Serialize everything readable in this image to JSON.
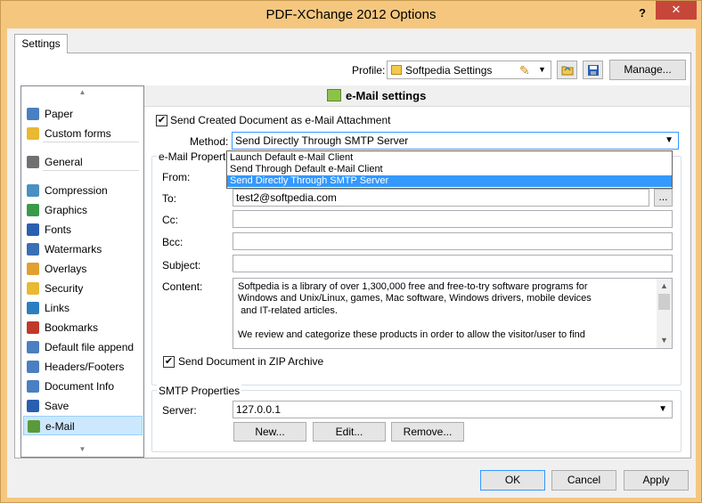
{
  "window": {
    "title": "PDF-XChange 2012 Options",
    "help_label": "?",
    "close_label": "✕"
  },
  "tabs": [
    {
      "label": "Settings"
    }
  ],
  "profile": {
    "label": "Profile:",
    "value": "Softpedia Settings",
    "manage_label": "Manage..."
  },
  "sidebar": {
    "items": [
      {
        "label": "Paper",
        "icon": "paper-icon",
        "color": "#4a7fc1"
      },
      {
        "label": "Custom forms",
        "icon": "custom-forms-icon",
        "color": "#e8b931"
      },
      {
        "label": "General",
        "icon": "gear-icon",
        "color": "#707070"
      },
      {
        "label": "Compression",
        "icon": "compression-icon",
        "color": "#4a90c2"
      },
      {
        "label": "Graphics",
        "icon": "graphics-icon",
        "color": "#3a9a4a"
      },
      {
        "label": "Fonts",
        "icon": "fonts-icon",
        "color": "#2a5fb0"
      },
      {
        "label": "Watermarks",
        "icon": "watermarks-icon",
        "color": "#3a6fb5"
      },
      {
        "label": "Overlays",
        "icon": "overlays-icon",
        "color": "#e0a030"
      },
      {
        "label": "Security",
        "icon": "shield-icon",
        "color": "#e8b931"
      },
      {
        "label": "Links",
        "icon": "links-icon",
        "color": "#2a7fc0"
      },
      {
        "label": "Bookmarks",
        "icon": "bookmarks-icon",
        "color": "#c0392b"
      },
      {
        "label": "Default file append",
        "icon": "file-append-icon",
        "color": "#4a7fc1"
      },
      {
        "label": "Headers/Footers",
        "icon": "headers-footers-icon",
        "color": "#4a7fc1"
      },
      {
        "label": "Document Info",
        "icon": "document-info-icon",
        "color": "#4a7fc1"
      },
      {
        "label": "Save",
        "icon": "save-icon",
        "color": "#2a5fb0"
      },
      {
        "label": "e-Mail",
        "icon": "email-icon",
        "color": "#5a9a3a"
      }
    ],
    "selected": "e-Mail"
  },
  "email": {
    "header_title": "e-Mail settings",
    "send_attachment_label": "Send Created Document as e-Mail Attachment",
    "send_attachment_checked": true,
    "method_label": "Method:",
    "method_value": "Send Directly Through SMTP Server",
    "method_options": [
      "Launch Default e-Mail Client",
      "Send Through Default e-Mail Client",
      "Send Directly Through SMTP Server"
    ],
    "properties_group": "e-Mail Properties",
    "from_label": "From:",
    "to_label": "To:",
    "to_value": "test2@softpedia.com",
    "browse_label": "...",
    "cc_label": "Cc:",
    "bcc_label": "Bcc:",
    "subject_label": "Subject:",
    "content_label": "Content:",
    "content_text": "Softpedia is a library of over 1,300,000 free and free-to-try software programs for\nWindows and Unix/Linux, games, Mac software, Windows drivers, mobile devices\n and IT-related articles.\n\nWe review and categorize these products in order to allow the visitor/user to find",
    "zip_label": "Send Document in ZIP Archive",
    "zip_checked": true,
    "smtp_group": "SMTP Properties",
    "server_label": "Server:",
    "server_value": "127.0.0.1",
    "new_label": "New...",
    "edit_label": "Edit...",
    "remove_label": "Remove..."
  },
  "footer": {
    "ok_label": "OK",
    "cancel_label": "Cancel",
    "apply_label": "Apply"
  }
}
